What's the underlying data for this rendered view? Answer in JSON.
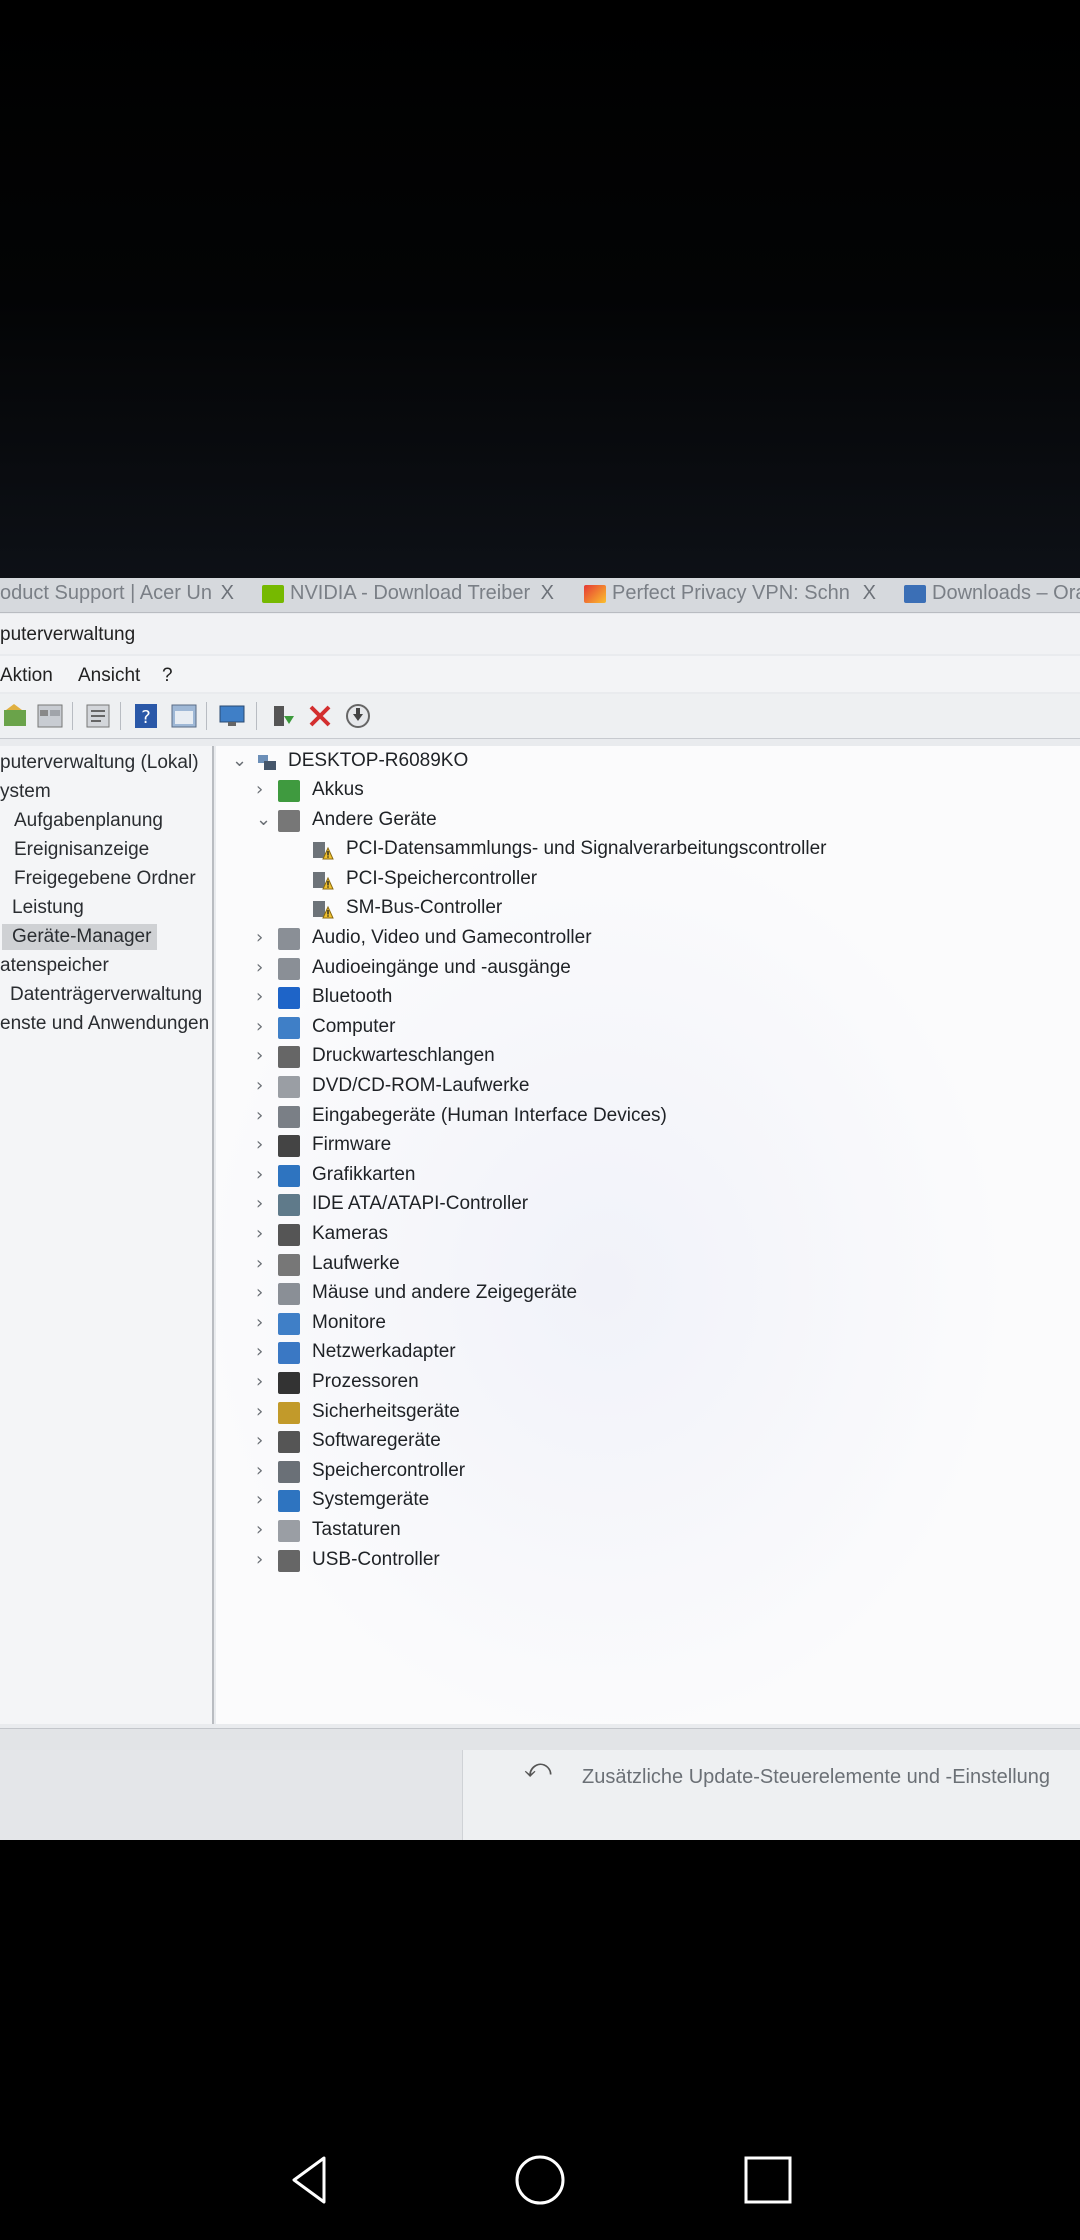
{
  "browser_tabs": [
    {
      "label": "oduct Support | Acer Un",
      "close": "X"
    },
    {
      "label": "NVIDIA - Download Treiber",
      "close": "X"
    },
    {
      "label": "Perfect Privacy VPN: Schn",
      "close": "X"
    },
    {
      "label": "Downloads – Ora",
      "close": ""
    }
  ],
  "window": {
    "title": "puterverwaltung"
  },
  "menu": [
    "Aktion",
    "Ansicht",
    "?"
  ],
  "toolbar_icons": [
    "back-icon",
    "grid-icon",
    "properties-icon",
    "help-icon",
    "view-icon",
    "monitor-icon",
    "update-driver-icon",
    "delete-icon",
    "download-icon"
  ],
  "left_tree": [
    {
      "label": "puterverwaltung (Lokal)"
    },
    {
      "label": "ystem"
    },
    {
      "label": "Aufgabenplanung"
    },
    {
      "label": "Ereignisanzeige"
    },
    {
      "label": "Freigegebene Ordner"
    },
    {
      "label": "Leistung"
    },
    {
      "label": "Geräte-Manager",
      "selected": true
    },
    {
      "label": "atenspeicher"
    },
    {
      "label": "Datenträgerverwaltung"
    },
    {
      "label": "enste und Anwendungen"
    }
  ],
  "left_scroll_arrow": ">",
  "device_tree": {
    "root": "DESKTOP-R6089KO",
    "categories": [
      {
        "label": "Akkus",
        "icon": "battery-icon",
        "expanded": false
      },
      {
        "label": "Andere Geräte",
        "icon": "unknown-device-icon",
        "expanded": true,
        "children": [
          "PCI-Datensammlungs- und Signalverarbeitungscontroller",
          "PCI-Speichercontroller",
          "SM-Bus-Controller"
        ]
      },
      {
        "label": "Audio, Video und Gamecontroller",
        "icon": "speaker-icon"
      },
      {
        "label": "Audioeingänge und -ausgänge",
        "icon": "speaker-icon"
      },
      {
        "label": "Bluetooth",
        "icon": "bluetooth-icon"
      },
      {
        "label": "Computer",
        "icon": "computer-icon"
      },
      {
        "label": "Druckwarteschlangen",
        "icon": "printer-icon"
      },
      {
        "label": "DVD/CD-ROM-Laufwerke",
        "icon": "disc-drive-icon"
      },
      {
        "label": "Eingabegeräte (Human Interface Devices)",
        "icon": "hid-icon"
      },
      {
        "label": "Firmware",
        "icon": "firmware-icon"
      },
      {
        "label": "Grafikkarten",
        "icon": "display-adapter-icon"
      },
      {
        "label": "IDE ATA/ATAPI-Controller",
        "icon": "ide-controller-icon"
      },
      {
        "label": "Kameras",
        "icon": "camera-icon"
      },
      {
        "label": "Laufwerke",
        "icon": "drive-icon"
      },
      {
        "label": "Mäuse und andere Zeigegeräte",
        "icon": "mouse-icon"
      },
      {
        "label": "Monitore",
        "icon": "monitor-icon"
      },
      {
        "label": "Netzwerkadapter",
        "icon": "network-adapter-icon"
      },
      {
        "label": "Prozessoren",
        "icon": "processor-icon"
      },
      {
        "label": "Sicherheitsgeräte",
        "icon": "security-device-icon"
      },
      {
        "label": "Softwaregeräte",
        "icon": "software-device-icon"
      },
      {
        "label": "Speichercontroller",
        "icon": "storage-controller-icon"
      },
      {
        "label": "Systemgeräte",
        "icon": "system-device-icon"
      },
      {
        "label": "Tastaturen",
        "icon": "keyboard-icon"
      },
      {
        "label": "USB-Controller",
        "icon": "usb-icon"
      }
    ]
  },
  "bottom_text": "Zusätzliche Update-Steuerelemente und -Einstellung",
  "navbar": [
    "back-nav-icon",
    "home-nav-icon",
    "recents-nav-icon"
  ]
}
